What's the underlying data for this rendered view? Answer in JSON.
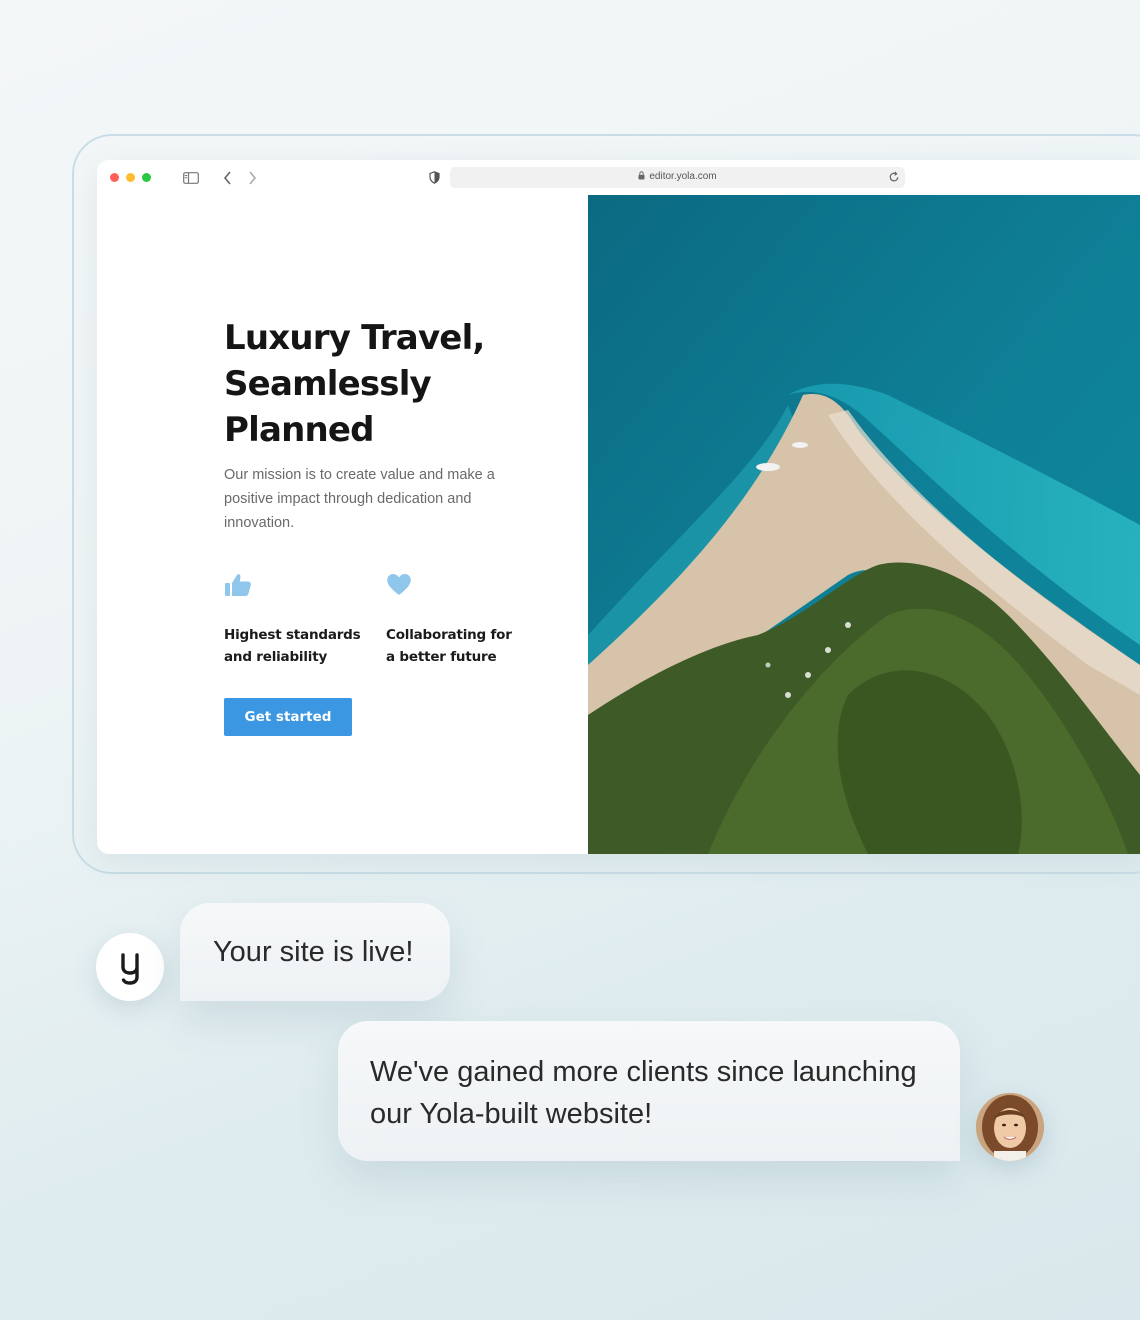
{
  "browser": {
    "url": "editor.yola.com",
    "icons": [
      "sidebar-toggle-icon",
      "back-arrow-icon",
      "forward-arrow-icon",
      "shield-icon",
      "lock-icon",
      "reload-icon"
    ]
  },
  "hero": {
    "title_line1": "Luxury Travel,",
    "title_line2": "Seamlessly",
    "title_line3": "Planned",
    "description": "Our mission is to create value and make a positive impact through dedication and innovation.",
    "features": [
      {
        "icon": "thumbs-up-icon",
        "line1": "Highest standards",
        "line2": "and reliability"
      },
      {
        "icon": "heart-icon",
        "line1": "Collaborating for",
        "line2": "a better future"
      }
    ],
    "cta_label": "Get started",
    "accent_color": "#3b97e2",
    "icon_color": "#8fc6ec"
  },
  "chat": {
    "message1": "Your site is live!",
    "message2_line1": "We've gained more clients since launching",
    "message2_line2": "our Yola-built website!",
    "yola_avatar_letter": "y"
  }
}
